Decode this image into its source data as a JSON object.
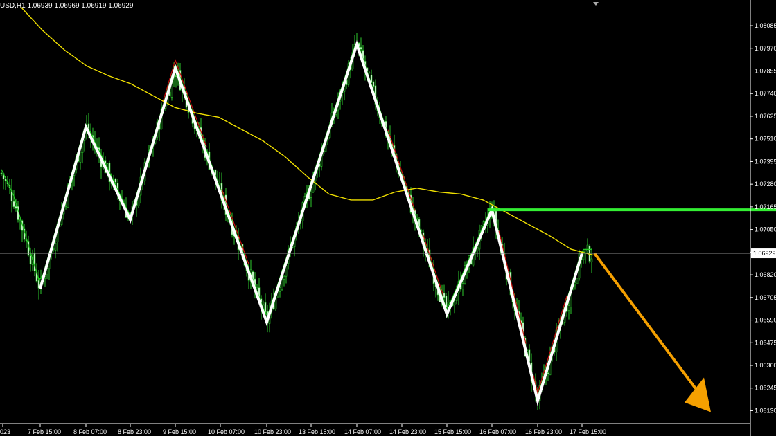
{
  "chart_data": {
    "type": "candlestick",
    "header": "USD,H1  1.06939 1.06969 1.06919 1.06929",
    "current_price": 1.06929,
    "y_ticks": [
      "1.08085",
      "1.07970",
      "1.07855",
      "1.07740",
      "1.07625",
      "1.07510",
      "1.07395",
      "1.07280",
      "1.07165",
      "1.07050",
      "1.06935",
      "1.06820",
      "1.06705",
      "1.06590",
      "1.06475",
      "1.06360",
      "1.06245",
      "1.06130"
    ],
    "ylim": [
      1.061,
      1.0818
    ],
    "x_ticks": [
      "023",
      "7 Feb 15:00",
      "8 Feb 07:00",
      "8 Feb 23:00",
      "9 Feb 15:00",
      "10 Feb 07:00",
      "10 Feb 23:00",
      "13 Feb 15:00",
      "14 Feb 07:00",
      "14 Feb 23:00",
      "15 Feb 15:00",
      "16 Feb 07:00",
      "16 Feb 23:00",
      "17 Feb 15:00"
    ],
    "zigzag": [
      {
        "x": "7 Feb 15:00",
        "y": 1.0675
      },
      {
        "x": "8 Feb 07:00",
        "y": 1.0757
      },
      {
        "x": "8 Feb 23:00",
        "y": 1.071
      },
      {
        "x": "9 Feb 15:00",
        "y": 1.0787
      },
      {
        "x": "10 Feb 23:00",
        "y": 1.0658
      },
      {
        "x": "14 Feb 07:00",
        "y": 1.0799
      },
      {
        "x": "15 Feb 15:00",
        "y": 1.0662
      },
      {
        "x": "16 Feb 07:00",
        "y": 1.0715
      },
      {
        "x": "16 Feb 23:00",
        "y": 1.0618
      },
      {
        "x": "17 Feb 15:00",
        "y": 1.06929
      }
    ],
    "resistance_level": 1.0715,
    "forecast": {
      "from": 1.06929,
      "to": 1.0613,
      "direction": "down"
    },
    "ma_slow": [
      1.0818,
      1.0806,
      1.0796,
      1.0788,
      1.0783,
      1.0779,
      1.0773,
      1.0767,
      1.0764,
      1.0762,
      1.0756,
      1.075,
      1.0742,
      1.0732,
      1.0723,
      1.072,
      1.072,
      1.0724,
      1.0726,
      1.0724,
      1.0723,
      1.072,
      1.0714,
      1.0708,
      1.0702,
      1.0695,
      1.0692
    ],
    "colors": {
      "bull": "#2ecc2e",
      "bear": "#ffffff",
      "ma_slow": "#f0e000",
      "ma_fast": "#22cc22",
      "ma_fast_down": "#cc1111",
      "zigzag": "#ffffff",
      "resistance": "#33ee33",
      "forecast": "#f5a000",
      "price_line": "#888888"
    }
  }
}
